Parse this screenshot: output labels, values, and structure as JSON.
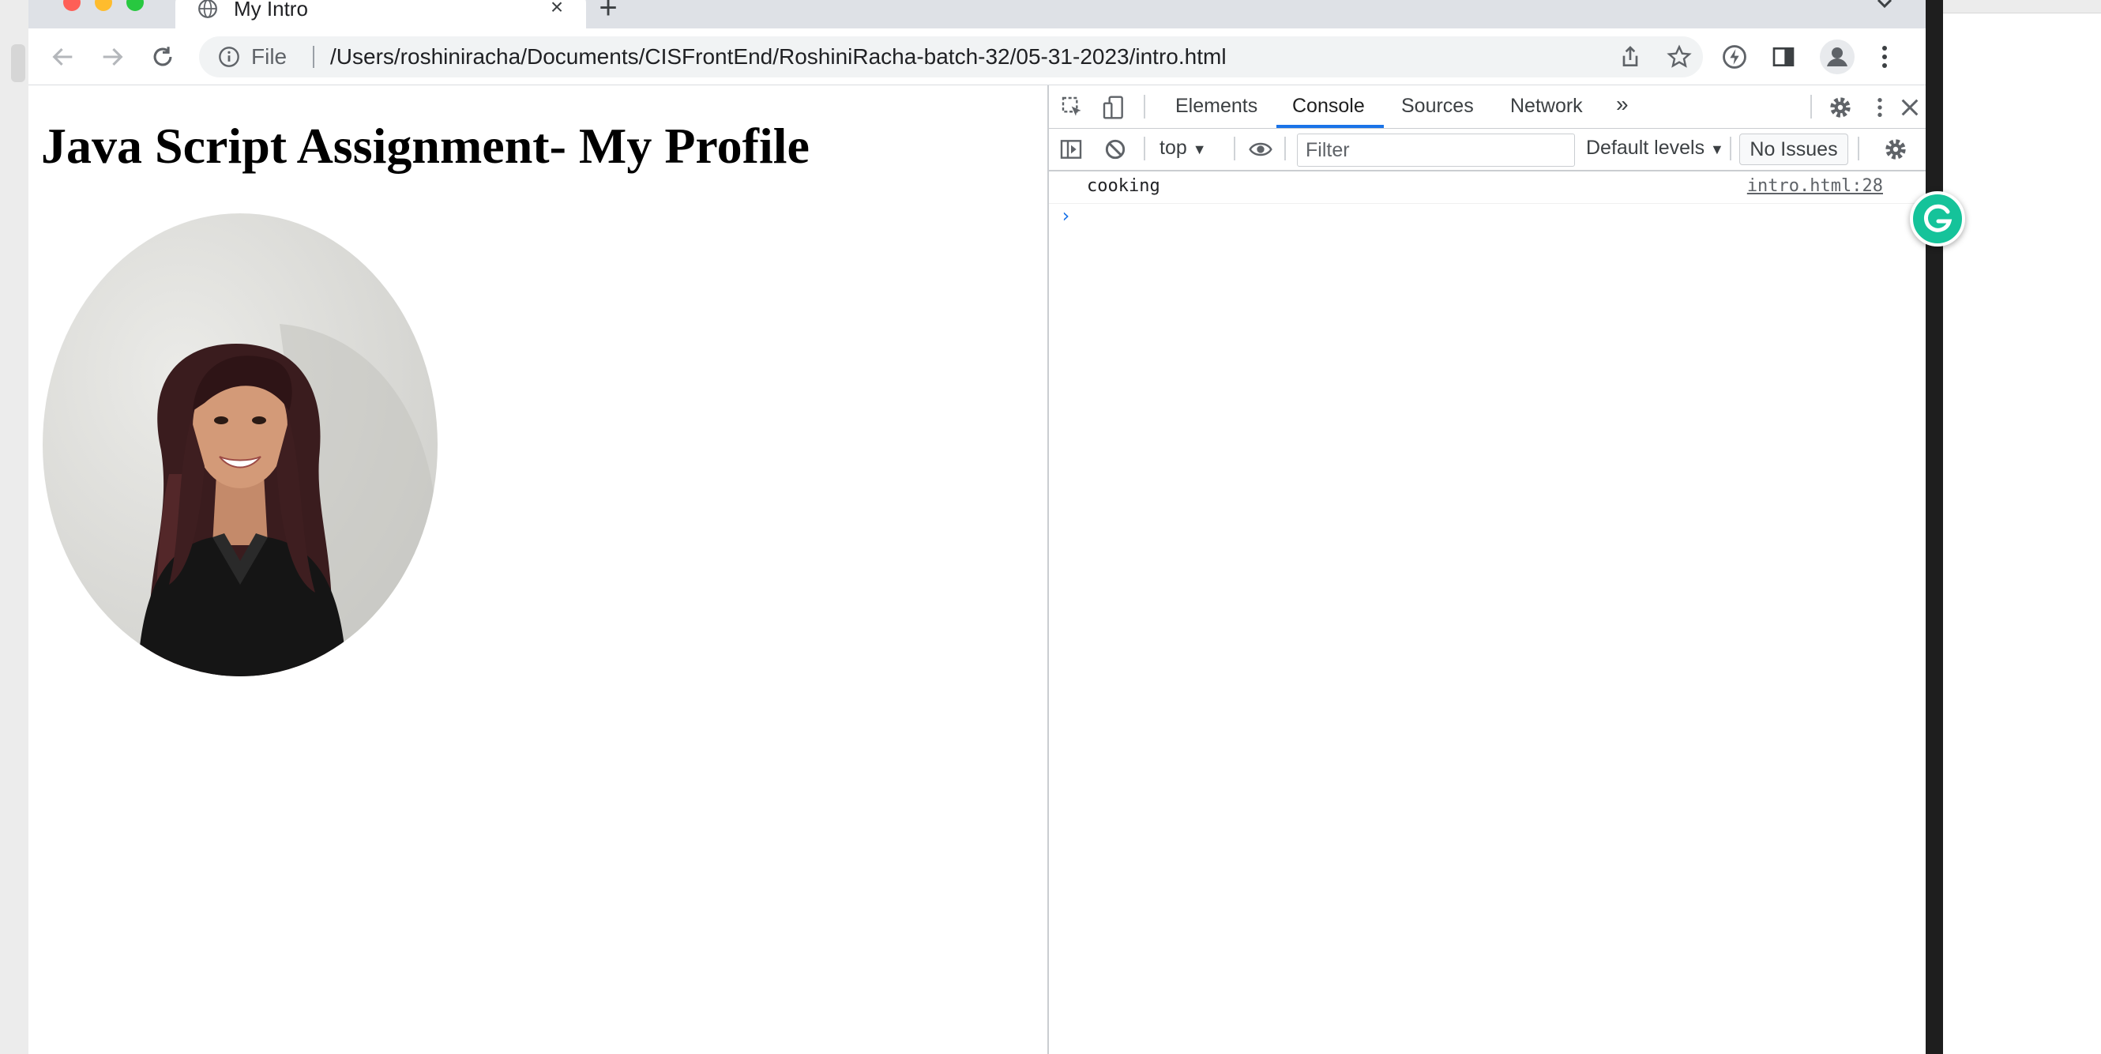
{
  "browser": {
    "tab_title": "My Intro",
    "close_tab_glyph": "×",
    "new_tab_glyph": "+",
    "address_scheme": "File",
    "address_url": "/Users/roshiniracha/Documents/CISFrontEnd/RoshiniRacha-batch-32/05-31-2023/intro.html"
  },
  "page": {
    "heading": "Java Script Assignment- My Profile"
  },
  "devtools": {
    "tabs": [
      "Elements",
      "Console",
      "Sources",
      "Network"
    ],
    "active_tab": "Console",
    "more_tabs_glyph": "»",
    "context": "top",
    "filter_placeholder": "Filter",
    "levels": "Default levels",
    "issues": "No Issues",
    "log": [
      {
        "message": "cooking",
        "source": "intro.html:28"
      }
    ],
    "prompt_glyph": "›"
  },
  "icons": {
    "back": "arrow-left-icon",
    "forward": "arrow-right-icon",
    "reload": "reload-icon",
    "site_info": "info-icon",
    "share": "share-icon",
    "bookmark": "star-icon",
    "extension": "extension-icon",
    "side_panel": "side-panel-icon",
    "profile": "profile-icon",
    "menu": "kebab-menu-icon",
    "grammarly": "grammarly-icon"
  },
  "colors": {
    "active_tab_underline": "#1a73e8",
    "grammarly": "#15c39a",
    "traffic_red": "#fe5f57",
    "traffic_yellow": "#febc2e",
    "traffic_green": "#28c840"
  }
}
